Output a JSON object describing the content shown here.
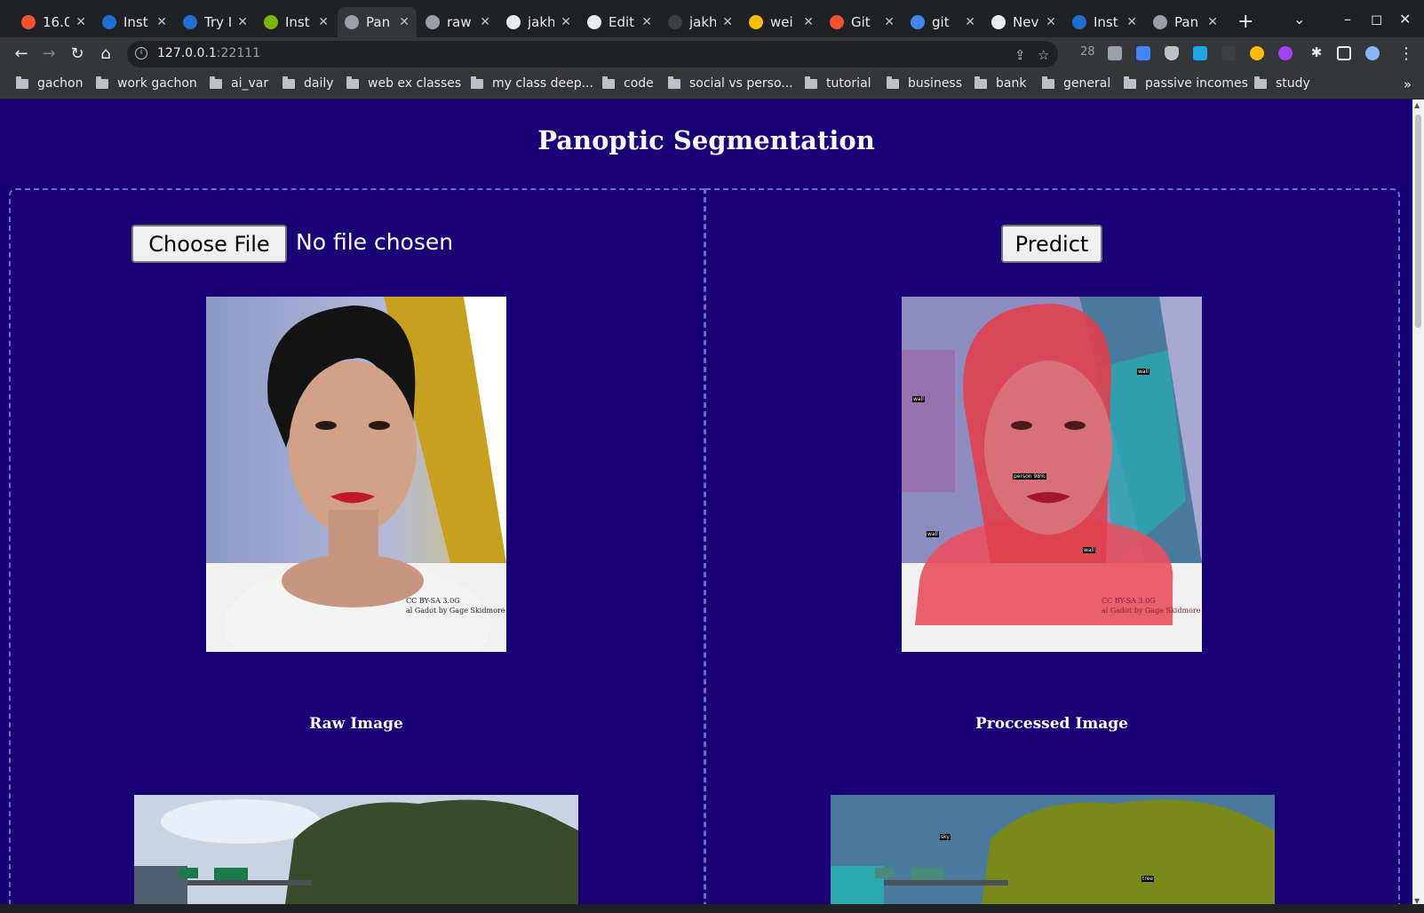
{
  "browser": {
    "tabs": [
      {
        "title": "16.0",
        "favicon_color": "#f2542d"
      },
      {
        "title": "Inst",
        "favicon_color": "#1f6fd0"
      },
      {
        "title": "Try I",
        "favicon_color": "#1f6fd0"
      },
      {
        "title": "Inst",
        "favicon_color": "#76b900"
      },
      {
        "title": "Pan",
        "favicon_color": "#9aa0a6",
        "active": true
      },
      {
        "title": "raw",
        "favicon_color": "#9aa0a6"
      },
      {
        "title": "jakh",
        "favicon_color": "#e8eaed"
      },
      {
        "title": "Edit",
        "favicon_color": "#e8eaed"
      },
      {
        "title": "jakh",
        "favicon_color": "#3c4043"
      },
      {
        "title": "wei",
        "favicon_color": "#fbbc04"
      },
      {
        "title": "Git",
        "favicon_color": "#f05133"
      },
      {
        "title": "git",
        "favicon_color": "#4285f4"
      },
      {
        "title": "Nev",
        "favicon_color": "#e8eaed"
      },
      {
        "title": "Inst",
        "favicon_color": "#1f6fd0"
      },
      {
        "title": "Pan",
        "favicon_color": "#9aa0a6"
      }
    ],
    "new_tab_label": "+",
    "url_host": "127.0.0.1",
    "url_port": ":22111",
    "extension_count": "28",
    "bookmarks": [
      "gachon",
      "work gachon",
      "ai_var",
      "daily",
      "web ex classes",
      "my class deep...",
      "code",
      "social vs perso...",
      "tutorial",
      "business",
      "bank",
      "general",
      "passive incomes",
      "study"
    ],
    "bookmarks_more": "»"
  },
  "page": {
    "title": "Panoptic Segmentation",
    "choose_file_label": "Choose File",
    "file_status": "No file chosen",
    "predict_label": "Predict",
    "raw_caption": "Raw Image",
    "processed_caption": "Proccessed Image",
    "image_credit_line1": "CC BY-SA 3.0G",
    "image_credit_line2": "al Gadot by Gage Skidmore",
    "seg_labels": [
      "person 98%",
      "wall",
      "wall",
      "wall",
      "wall",
      "sky",
      "tree"
    ]
  },
  "colors": {
    "page_bg": "#1a0076",
    "panel_border": "#6a6ad6",
    "seg_person": "#e8404e",
    "seg_tree": "#7a8a1a",
    "seg_sky": "#4a7aa0"
  }
}
